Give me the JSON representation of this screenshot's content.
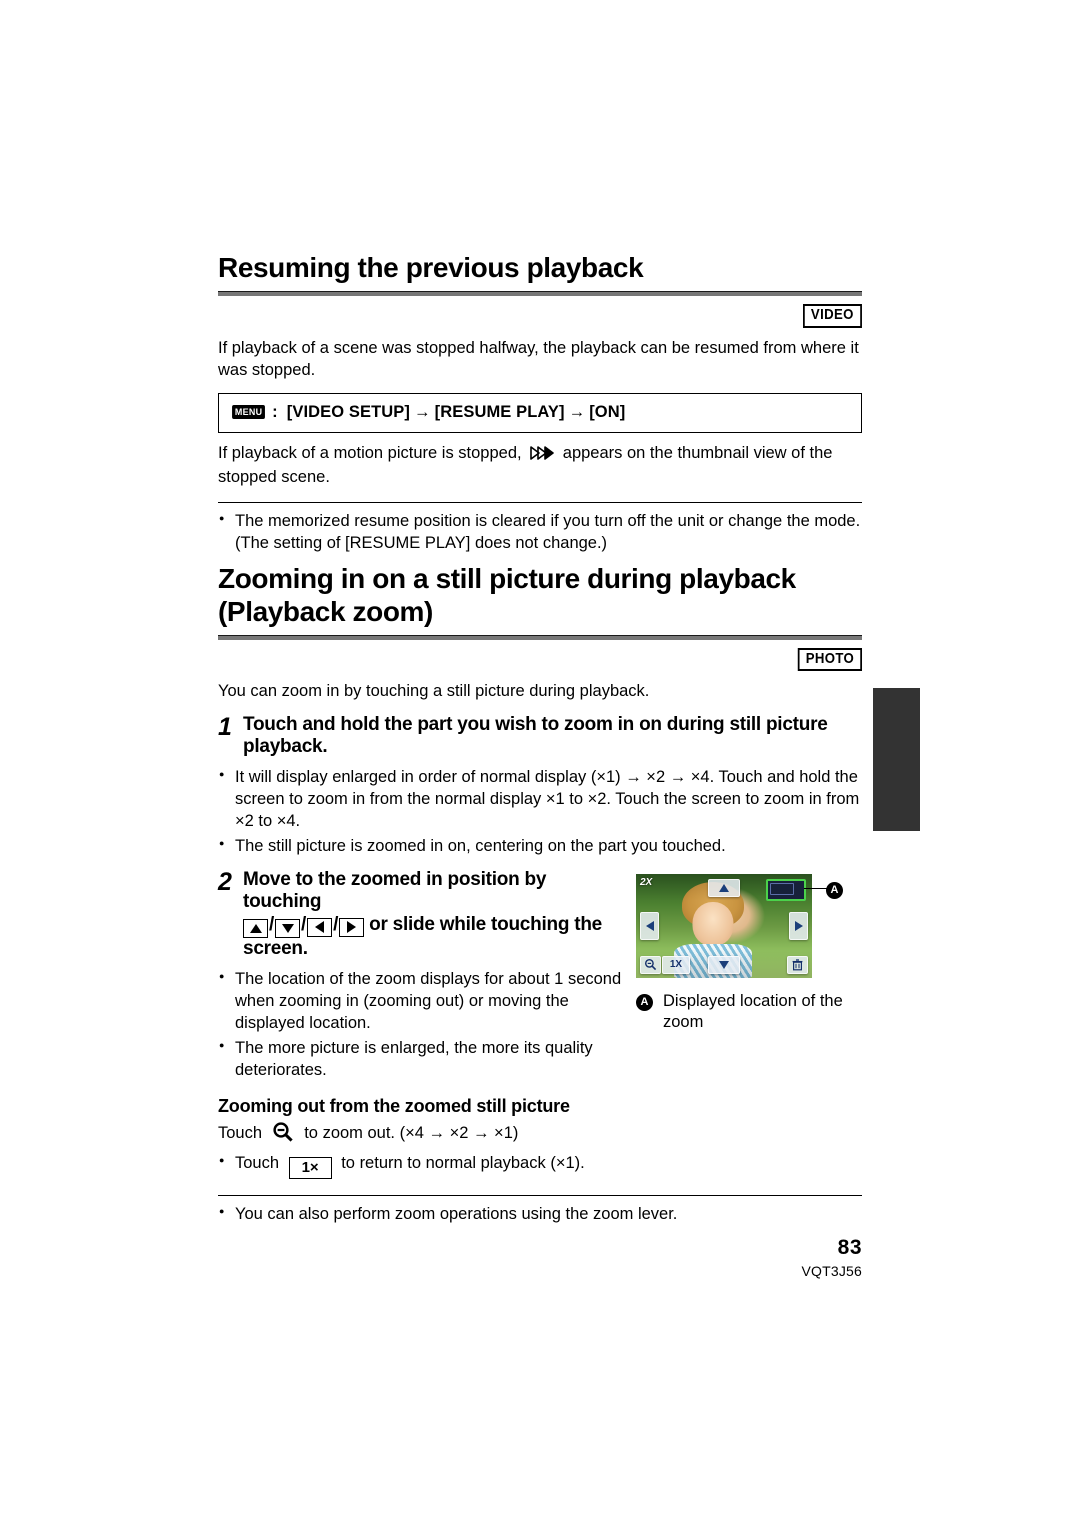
{
  "document": {
    "page_number": "83",
    "doc_code": "VQT3J56"
  },
  "sections": [
    {
      "heading": "Resuming the previous playback",
      "badge": "VIDEO",
      "intro": "If playback of a scene was stopped halfway, the playback can be resumed from where it was stopped.",
      "menu_path": {
        "chip": "MENU",
        "prefix": ":",
        "item1": "[VIDEO SETUP]",
        "arrow1": "→",
        "item2": "[RESUME PLAY]",
        "arrow2": "→",
        "item3": "[ON]"
      },
      "after_menu_a": "If playback of a motion picture is stopped,",
      "after_menu_b": "appears on the thumbnail view of the stopped scene.",
      "notes": [
        "The memorized resume position is cleared if you turn off the unit or change the mode. (The setting of [RESUME PLAY] does not change.)"
      ]
    },
    {
      "heading_line1": "Zooming in on a still picture during playback",
      "heading_line2": "(Playback zoom)",
      "badge": "PHOTO",
      "intro": "You can zoom in by touching a still picture during playback.",
      "steps": [
        {
          "number": "1",
          "text": "Touch and hold the part you wish to zoom in on during still picture playback.",
          "bullets": [
            "It will display enlarged in order of normal display (×1) → ×2 → ×4. Touch and hold the screen to zoom in from the normal display ×1 to ×2. Touch the screen to zoom in from ×2 to ×4.",
            "The still picture is zoomed in on, centering on the part you touched."
          ]
        },
        {
          "number": "2",
          "text_before_keys": "Move to the zoomed in position by touching",
          "text_after_keys": "or slide while touching the screen.",
          "keys": [
            "up",
            "down",
            "left",
            "right"
          ],
          "bullets": [
            "The location of the zoom displays for about 1 second when zooming in (zooming out) or moving the displayed location.",
            "The more picture is enlarged, the more its quality deteriorates."
          ]
        }
      ],
      "figure": {
        "zoom_label": "2X",
        "one_x_label": "1X",
        "callout_marker": "A",
        "caption": "Displayed location of the zoom",
        "buttons": [
          "up-arrow",
          "down-arrow",
          "left-arrow",
          "right-arrow",
          "zoom-out-magnifier",
          "1X",
          "trash"
        ]
      },
      "subsection": {
        "heading": "Zooming out from the zoomed still picture",
        "line1_before": "Touch",
        "line1_after": "to zoom out. (×4 → ×2 → ×1)",
        "line2_before": "Touch",
        "line2_button": "1×",
        "line2_after": "to return to normal playback (×1)."
      },
      "final_notes": [
        "You can also perform zoom operations using the zoom lever."
      ]
    }
  ]
}
